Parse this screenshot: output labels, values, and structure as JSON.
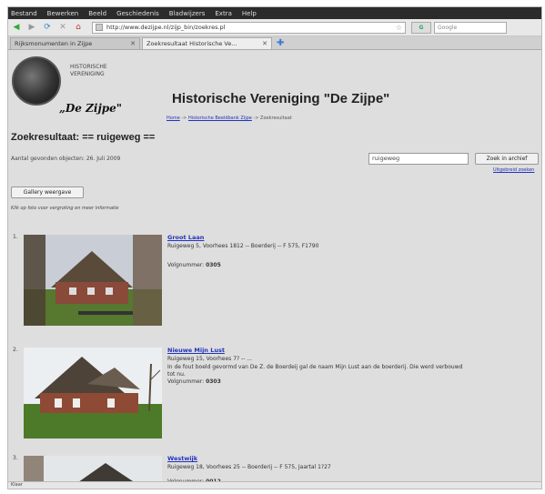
{
  "menu": [
    "Bestand",
    "Bewerken",
    "Beeld",
    "Geschiedenis",
    "Bladwijzers",
    "Extra",
    "Help"
  ],
  "toolbar": {
    "url": "http://www.dezijpe.nl/zijp_bin/zoekres.pl",
    "search_engine": "G",
    "search_placeholder": "Google"
  },
  "tabs": [
    {
      "label": "Rijksmonumenten in Zijpe"
    },
    {
      "label": "Zoekresultaat Historische Ve..."
    }
  ],
  "page": {
    "logo_text": "HISTORISCHE VERENIGING",
    "logo_brand": "„De Zijpe\"",
    "title": "Historische Vereniging \"De Zijpe\"",
    "breadcrumb": {
      "home": "Home",
      "sep1": " -> ",
      "link": "Historische Beeldbank Zijpe",
      "sep2": " -> ",
      "current": "Zoekresultaat"
    },
    "results_title": "Zoekresultaat:  == ruigeweg ==",
    "results_count": "Aantal gevonden objecten: 26.  Juli 2009",
    "search_value": "ruigeweg",
    "search_button": "Zoek in archief",
    "advanced_link": "Uitgebreid zoeken",
    "gallery_button": "Gallery weergave",
    "hint": "Klik op foto voor vergroting en meer informatie"
  },
  "results": [
    {
      "num": "1.",
      "title": "Groot Laan",
      "address": "Ruigeweg 5, Voorhees 1812   --   Boerderij   --   F 575, F1790",
      "description": "",
      "vol_label": "Volgnummer:",
      "vol_number": "0305"
    },
    {
      "num": "2.",
      "title": "Nieuwe Mijn Lust",
      "address": "Ruigeweg 15, Voorhees 7?   --   ...",
      "description": "In de fout boeld gevormd van De Z. de Boerdeij gal de naam Mijn Lust aan de boerderij. Die werd verbouwd tot nu.",
      "vol_label": "Volgnummer:",
      "vol_number": "0303"
    },
    {
      "num": "3.",
      "title": "Westwijk",
      "address": "Ruigeweg 18, Voorhees 25   --   Boerderij   --   F 575, Jaartal 1?27",
      "description": "",
      "vol_label": "Volgnummer:",
      "vol_number": "0012"
    }
  ],
  "status": "Klaar"
}
